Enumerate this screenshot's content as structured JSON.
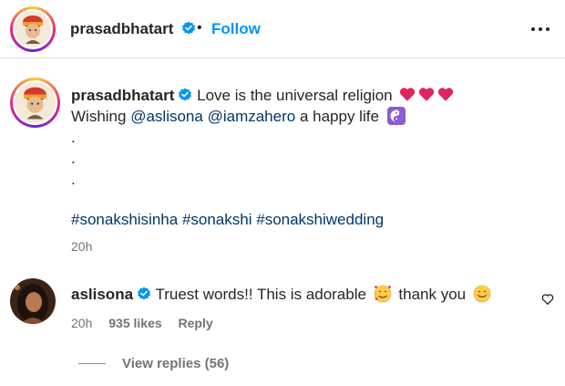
{
  "header": {
    "username": "prasadbhatart",
    "separator": "•",
    "follow_label": "Follow"
  },
  "caption": {
    "username": "prasadbhatart",
    "line1_text": "Love is the universal religion",
    "line2_prefix": "Wishing",
    "mention1": "@aslisona",
    "mention2": "@iamzahero",
    "line2_suffix": "a happy life",
    "dot": ".",
    "hashtag1": "#sonakshisinha",
    "hashtag2": "#sonakshi",
    "hashtag3": "#sonakshiwedding",
    "time": "20h"
  },
  "comment": {
    "username": "aslisona",
    "text1": "Truest words!! This is adorable",
    "text2": "thank you",
    "time": "20h",
    "likes": "935 likes",
    "reply_label": "Reply",
    "view_replies": "View replies (56)"
  },
  "colors": {
    "link": "#00376b",
    "follow": "#0095f6",
    "verified": "#0095f6",
    "heart": "#e0245e",
    "muted": "#737373"
  },
  "icons": [
    "verified-badge-icon",
    "more-options-icon",
    "red-heart-icon",
    "yin-yang-icon",
    "smiling-face-with-hearts-icon",
    "smiling-face-icon",
    "like-heart-icon"
  ]
}
